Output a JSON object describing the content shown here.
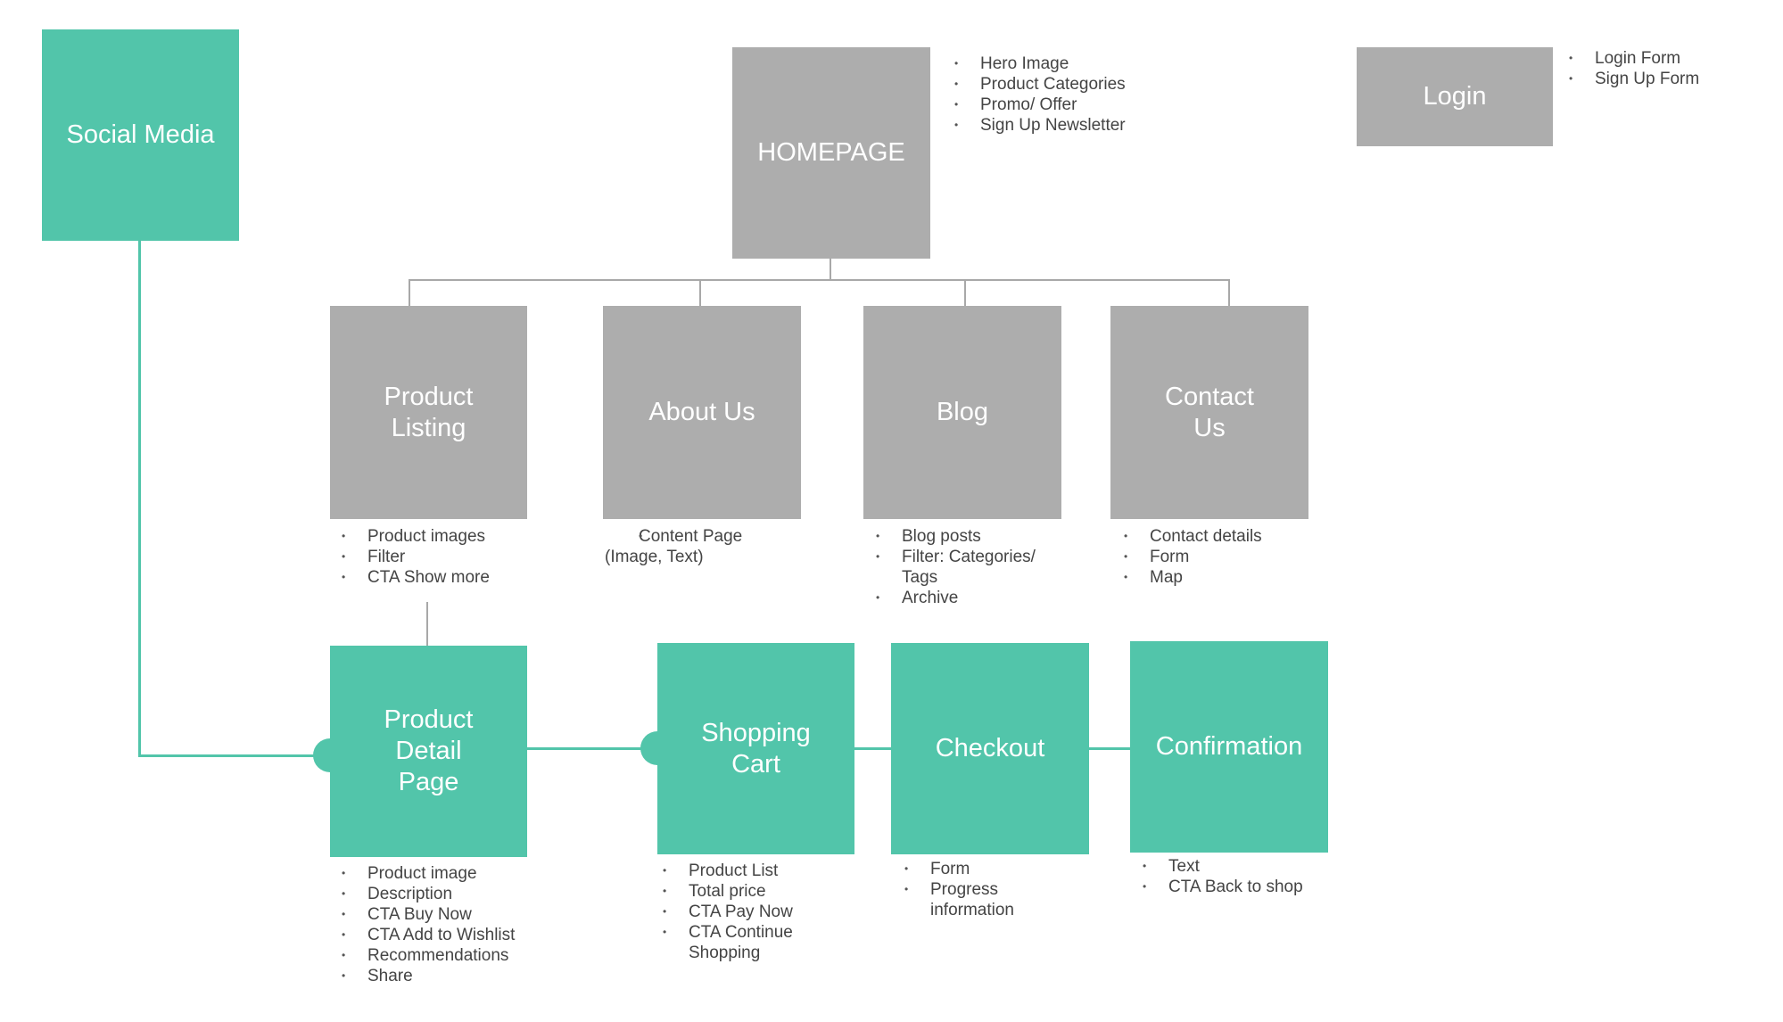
{
  "colors": {
    "primary_flow": "#52c5aa",
    "secondary_pages": "#adadad",
    "text": "#444444"
  },
  "nodes": {
    "social_media": {
      "label": "Social Media",
      "items": []
    },
    "homepage": {
      "label": "HOMEPAGE",
      "items": [
        "Hero Image",
        "Product Categories",
        "Promo/ Offer",
        "Sign Up Newsletter"
      ]
    },
    "login": {
      "label": "Login",
      "items": [
        "Login Form",
        "Sign Up Form"
      ]
    },
    "product_listing": {
      "label": "Product Listing",
      "items": [
        "Product images",
        "Filter",
        "CTA Show more"
      ]
    },
    "about_us": {
      "label": "About Us",
      "items": [
        "Content Page (Image, Text)"
      ]
    },
    "blog": {
      "label": "Blog",
      "items": [
        "Blog posts",
        "Filter: Categories/ Tags",
        "Archive"
      ]
    },
    "contact_us": {
      "label": "Contact Us",
      "items": [
        "Contact details",
        "Form",
        "Map"
      ]
    },
    "product_detail": {
      "label": "Product Detail Page",
      "items": [
        "Product image",
        "Description",
        "CTA Buy Now",
        "CTA Add to Wishlist",
        "Recommendations",
        "Share"
      ]
    },
    "shopping_cart": {
      "label": "Shopping Cart",
      "items": [
        "Product List",
        "Total price",
        "CTA Pay Now",
        "CTA Continue Shopping"
      ]
    },
    "checkout": {
      "label": "Checkout",
      "items": [
        "Form",
        "Progress information"
      ]
    },
    "confirmation": {
      "label": "Confirmation",
      "items": [
        "Text",
        "CTA Back to shop"
      ]
    }
  }
}
